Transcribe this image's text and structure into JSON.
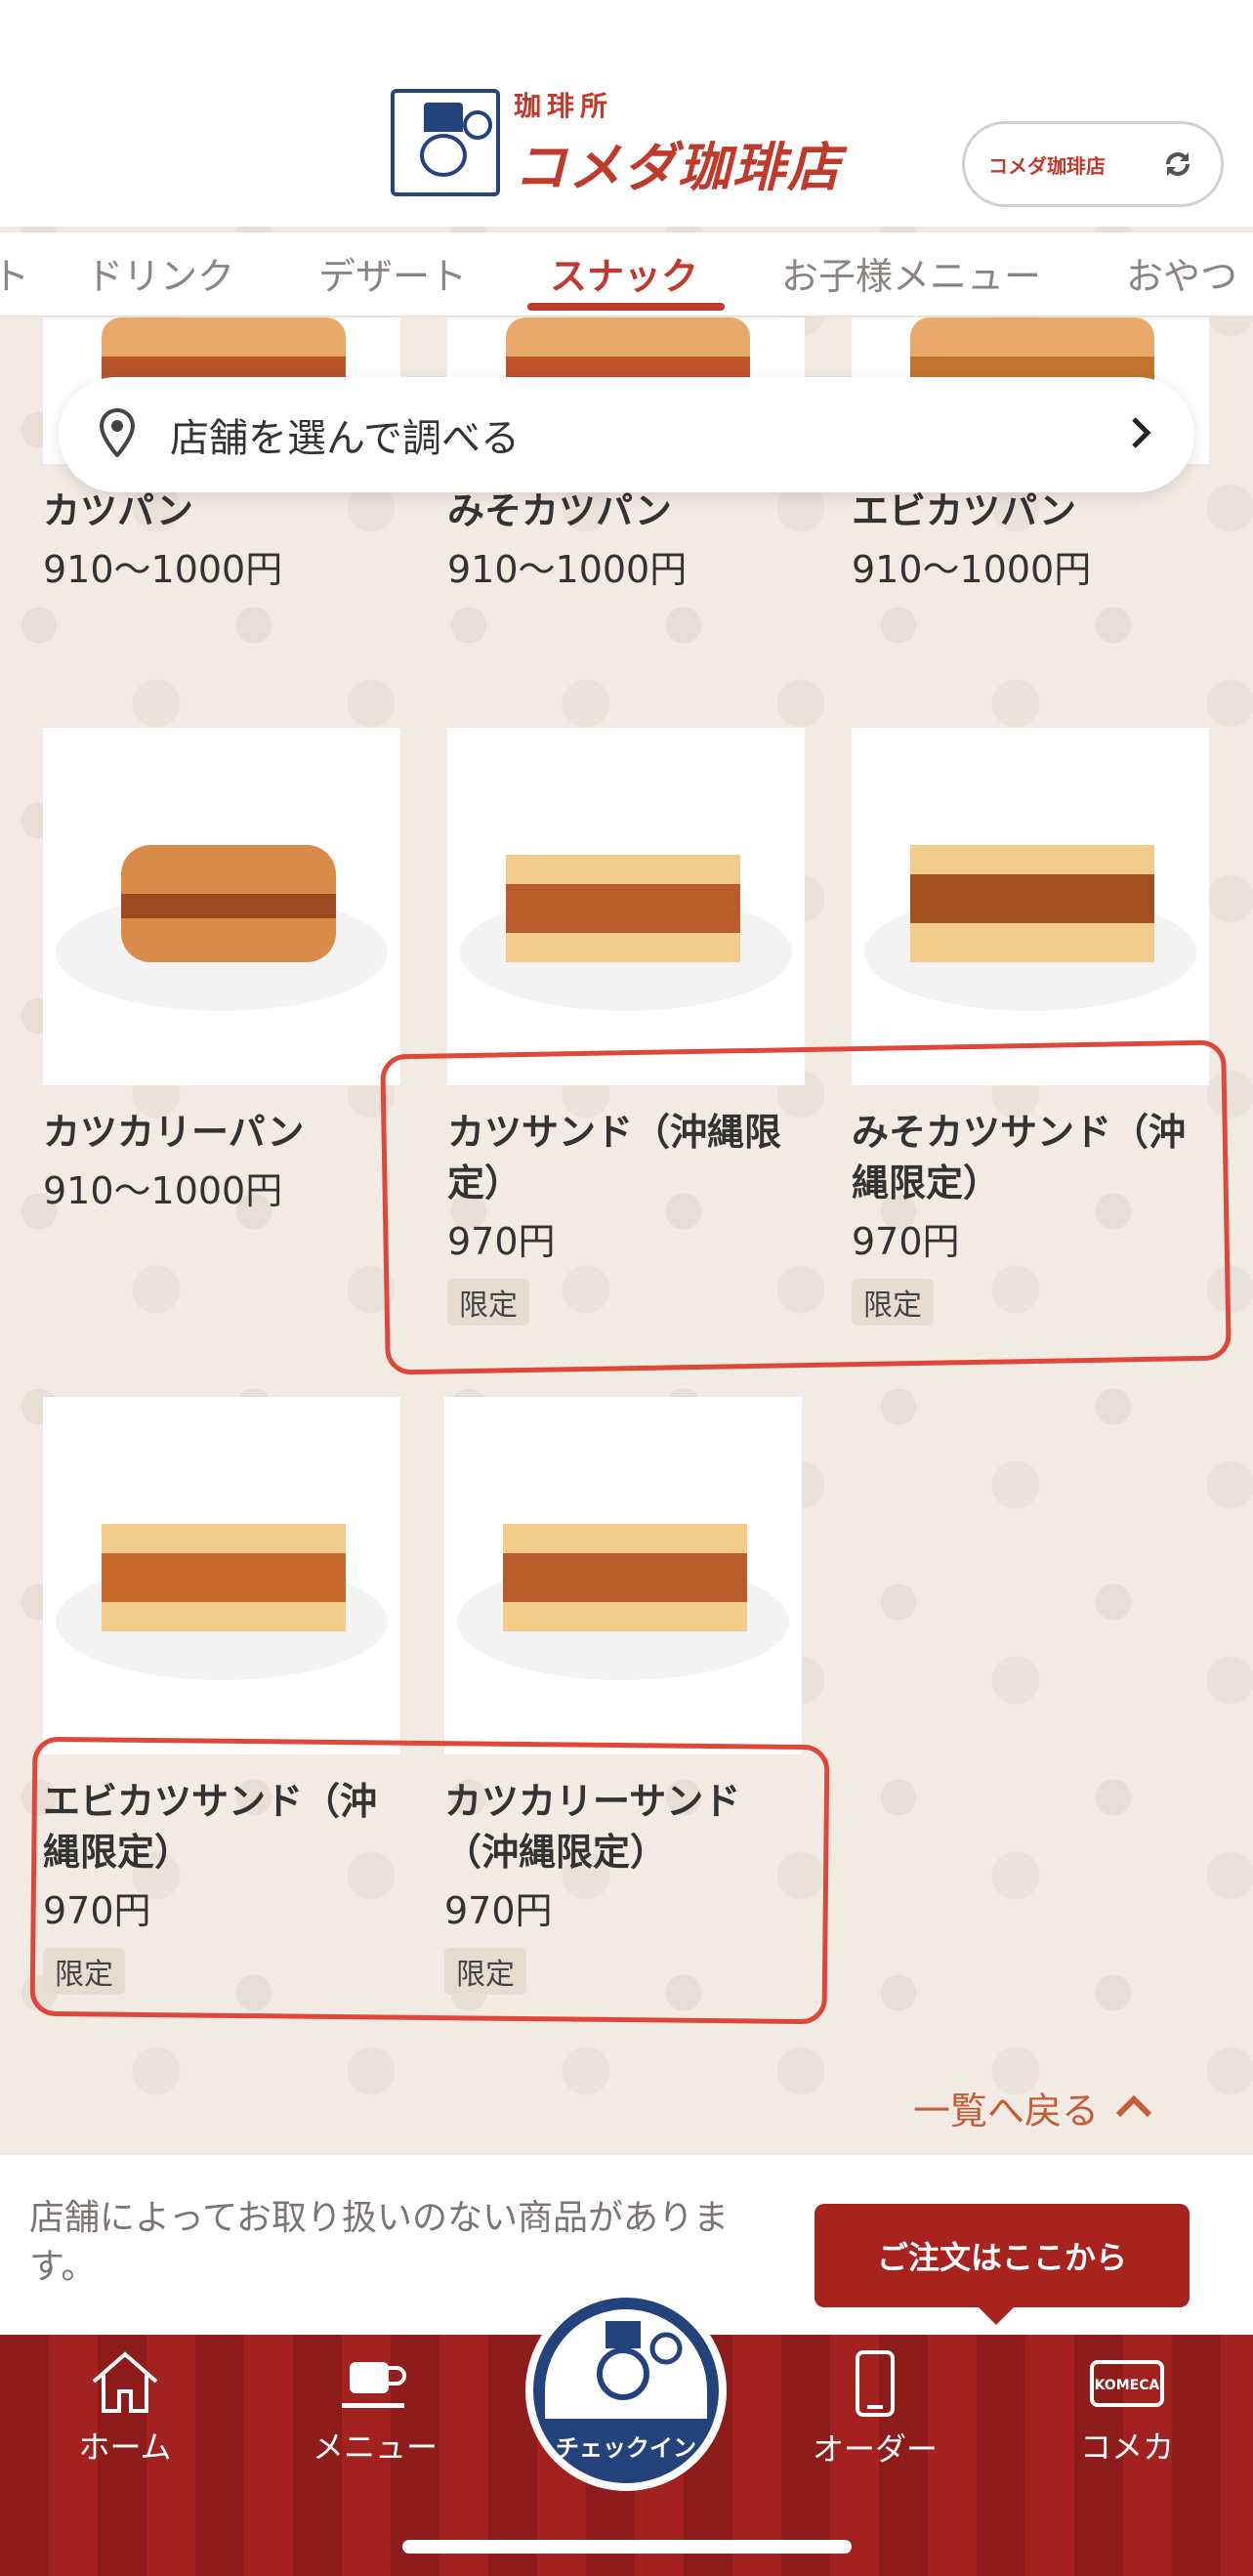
{
  "header": {
    "brand_sub": "珈琲所",
    "brand_main": "コメダ珈琲店",
    "store_logo_text": "コメダ珈琲店"
  },
  "tabs": [
    {
      "label": "ト"
    },
    {
      "label": "ドリンク"
    },
    {
      "label": "デザート"
    },
    {
      "label": "スナック",
      "active": true
    },
    {
      "label": "お子様メニュー"
    },
    {
      "label": "おやつ"
    }
  ],
  "store_search": {
    "label": "店舗を選んで調べる"
  },
  "products": [
    {
      "name": "カツパン",
      "price": "910〜1000円",
      "tag": ""
    },
    {
      "name": "みそカツパン",
      "price": "910〜1000円",
      "tag": ""
    },
    {
      "name": "エビカツパン",
      "price": "910〜1000円",
      "tag": ""
    },
    {
      "name": "カツカリーパン",
      "price": "910〜1000円",
      "tag": ""
    },
    {
      "name": "カツサンド（沖縄限定）",
      "price": "970円",
      "tag": "限定"
    },
    {
      "name": "みそカツサンド（沖縄限定）",
      "price": "970円",
      "tag": "限定"
    },
    {
      "name": "エビカツサンド（沖縄限定）",
      "price": "970円",
      "tag": "限定"
    },
    {
      "name": "カツカリーサンド（沖縄限定）",
      "price": "970円",
      "tag": "限定"
    }
  ],
  "back_link": "一覧へ戻る",
  "notice": "店舗によってお取り扱いのない商品があります。",
  "order_button": "ご注文はここから",
  "nav": {
    "home": "ホーム",
    "menu": "メニュー",
    "checkin": "チェックイン",
    "order": "オーダー",
    "komeka": "コメカ",
    "komeka_card": "KOMECA"
  },
  "colors": {
    "accent": "#c0392b",
    "nav_bg": "#8e1c1a",
    "brand_blue": "#24427b",
    "annotation": "#e0473b"
  }
}
